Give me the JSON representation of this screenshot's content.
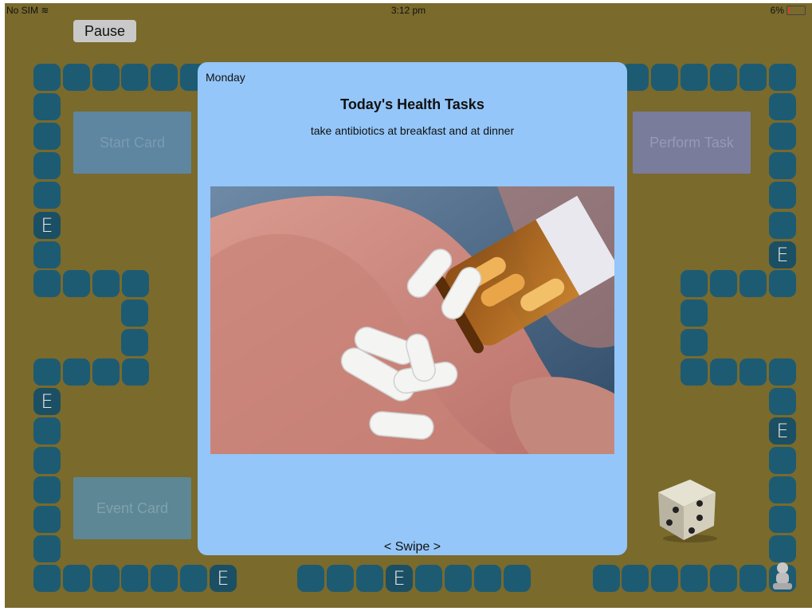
{
  "status_bar": {
    "carrier": "No SIM",
    "time": "3:12 pm",
    "battery": "6%",
    "battery_color": "#e03a2a"
  },
  "pause_label": "Pause",
  "board": {
    "start_card_label": "Start Card",
    "perform_task_label": "Perform Task",
    "event_card_label": "Event Card",
    "event_tile_label": "E",
    "tile_color": "#1d5b73",
    "background_color": "#7a6a2c"
  },
  "modal": {
    "day": "Monday",
    "title": "Today's Health Tasks",
    "task": "take antibiotics at breakfast and at dinner",
    "image_icon": "pills-in-hand-photo",
    "swipe_hint": "< Swipe >",
    "background_color": "#94c6f9"
  }
}
